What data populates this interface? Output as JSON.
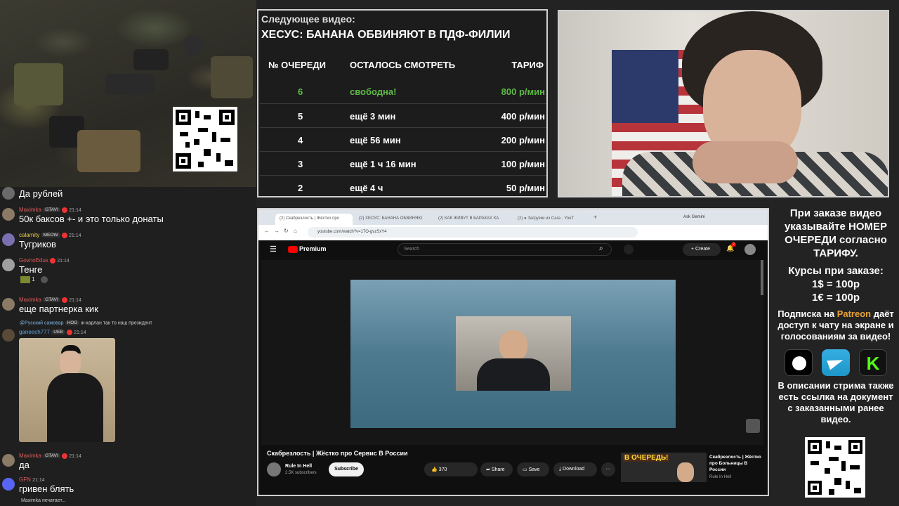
{
  "queue": {
    "next_label": "Следующее видео:",
    "next_title": "ХЕСУС: БАНАНА ОБВИНЯЮТ В ПДФ-ФИЛИИ",
    "columns": [
      "№ ОЧЕРЕДИ",
      "ОСТАЛОСЬ СМОТРЕТЬ",
      "ТАРИФ"
    ],
    "rows": [
      {
        "num": "6",
        "remaining": "свободна!",
        "rate": "800 р/мин",
        "highlight": true
      },
      {
        "num": "5",
        "remaining": "ещё 3 мин",
        "rate": "400 р/мин"
      },
      {
        "num": "4",
        "remaining": "ещё 56 мин",
        "rate": "200 р/мин"
      },
      {
        "num": "3",
        "remaining": "ещё 1 ч 16 мин",
        "rate": "100 р/мин"
      },
      {
        "num": "2",
        "remaining": "ещё 4 ч",
        "rate": "50 р/мин"
      }
    ],
    "colors": {
      "highlight": "#5dbb46",
      "text": "#ffffff"
    }
  },
  "chat": {
    "messages": [
      {
        "text": "Да рублей"
      },
      {
        "user": "Maximka",
        "badge": "GTAVI",
        "time": "21:14",
        "text": "50к баксов +- и это только донаты",
        "color": "#e05a5a"
      },
      {
        "user": "calamity",
        "badge": "MEOW",
        "time": "21:14",
        "text": "Тугриков",
        "color": "#e3c84a"
      },
      {
        "user": "GovnoEdus",
        "time": "21:14",
        "text": "Тенге",
        "reaction": "1",
        "color": "#e05a5a"
      },
      {
        "user": "Maximka",
        "badge": "GTAVI",
        "time": "21:14",
        "text": "еще партнерка кик",
        "color": "#e05a5a"
      },
      {
        "reply_to": "@Русский самовар",
        "reply_badge": "HOG",
        "reply_text": "ж-карлан так то наш президент",
        "user": "ganeech777",
        "badge": "UEB",
        "time": "21:14",
        "color": "#5aa0e0"
      },
      {
        "user": "Maximka",
        "badge": "GTAVI",
        "time": "21:14",
        "text": "да",
        "color": "#e05a5a"
      },
      {
        "user": "GFN",
        "time": "21:14",
        "text": "гривен блять",
        "color": "#e05a5a"
      }
    ],
    "typing": "Maximka печатает..."
  },
  "browser": {
    "tabs": [
      "(2) Скабрезлость | Жёстко про",
      "(2) ХЕСУС: БАНАНА ОБВИНЯЮ",
      "(2) КАК ЖИВУТ В БАРАКАХ КА",
      "(2) ● Загрузки из Сага · YouT"
    ],
    "gemini": "Ask Gemini",
    "url": "youtube.com/watch?v=17O-gvzSxY4",
    "logo": "Premium",
    "search_placeholder": "Search",
    "create": "Create",
    "notif_count": "2",
    "video_title": "Скабрезлость | Жёстко про Сервис В России",
    "channel": "Rule In Hell",
    "subs": "2.5K subscribers",
    "subscribe": "Subscribe",
    "likes": "370",
    "share": "Share",
    "save": "Save",
    "download": "Download",
    "more": "···",
    "reco_title": "Скабрезлость | Жёстко про Больницы В России",
    "reco_channel": "Rule In Hell",
    "reco_banner": "В ОЧЕРЕДЬ!"
  },
  "info": {
    "order_text": "При заказе видео указывайте НОМЕР ОЧЕРЕДИ согласно ТАРИФУ.",
    "rates_label": "Курсы при заказе:",
    "rate_usd": "1$ = 100р",
    "rate_eur": "1€ = 100р",
    "sub_pre": "Подписка на",
    "patreon": "Patreon",
    "sub_post": "даёт доступ к чату на экране и голосованиям за видео!",
    "desc": "В описании стрима также есть ссылка на документ с заказанными ранее видео.",
    "patreon_color": "#e8a33a"
  }
}
